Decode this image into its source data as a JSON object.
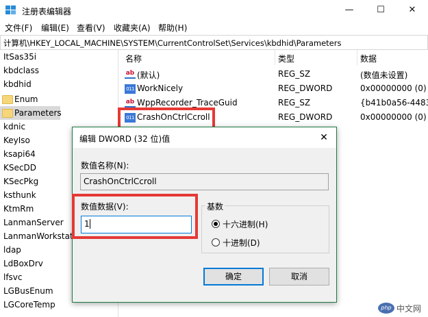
{
  "window": {
    "title": "注册表编辑器",
    "minimize": "—",
    "maximize": "☐",
    "close": "✕"
  },
  "menu": [
    "文件(F)",
    "编辑(E)",
    "查看(V)",
    "收藏夹(A)",
    "帮助(H)"
  ],
  "address": "计算机\\HKEY_LOCAL_MACHINE\\SYSTEM\\CurrentControlSet\\Services\\kbdhid\\Parameters",
  "tree": {
    "items": [
      {
        "label": "ItSas35i",
        "folder": false,
        "selected": false
      },
      {
        "label": "kbdclass",
        "folder": false,
        "selected": false
      },
      {
        "label": "kbdhid",
        "folder": false,
        "selected": false
      },
      {
        "label": "Enum",
        "folder": true,
        "selected": false
      },
      {
        "label": "Parameters",
        "folder": true,
        "selected": true
      },
      {
        "label": "kdnic",
        "folder": false,
        "selected": false
      },
      {
        "label": "KeyIso",
        "folder": false,
        "selected": false
      },
      {
        "label": "ksapi64",
        "folder": false,
        "selected": false
      },
      {
        "label": "KSecDD",
        "folder": false,
        "selected": false
      },
      {
        "label": "KSecPkg",
        "folder": false,
        "selected": false
      },
      {
        "label": "ksthunk",
        "folder": false,
        "selected": false
      },
      {
        "label": "KtmRm",
        "folder": false,
        "selected": false
      },
      {
        "label": "LanmanServer",
        "folder": false,
        "selected": false
      },
      {
        "label": "LanmanWorkstati",
        "folder": false,
        "selected": false
      },
      {
        "label": "ldap",
        "folder": false,
        "selected": false
      },
      {
        "label": "LdBoxDrv",
        "folder": false,
        "selected": false
      },
      {
        "label": "lfsvc",
        "folder": false,
        "selected": false
      },
      {
        "label": "LGBusEnum",
        "folder": false,
        "selected": false
      },
      {
        "label": "LGCoreTemp",
        "folder": false,
        "selected": false
      }
    ]
  },
  "list": {
    "headers": {
      "name": "名称",
      "type": "类型",
      "data": "数据"
    },
    "rows": [
      {
        "icon": "string-value-icon",
        "icon_text": "ab",
        "name": "(默认)",
        "type": "REG_SZ",
        "data": "(数值未设置)"
      },
      {
        "icon": "binary-value-icon",
        "icon_text": "011",
        "name": "WorkNicely",
        "type": "REG_DWORD",
        "data": "0x00000000 (0)"
      },
      {
        "icon": "string-value-icon",
        "icon_text": "ab",
        "name": "WppRecorder_TraceGuid",
        "type": "REG_SZ",
        "data": "{b41b0a56-4483"
      },
      {
        "icon": "binary-value-icon",
        "icon_text": "011",
        "name": "CrashOnCtrlCcroll",
        "type": "REG_DWORD",
        "data": "0x00000000 (0)"
      }
    ]
  },
  "dialog": {
    "title": "编辑 DWORD (32 位)值",
    "close": "✕",
    "value_name_label": "数值名称(N):",
    "value_name": "CrashOnCtrlCcroll",
    "value_data_label": "数值数据(V):",
    "value_data": "1",
    "base_label": "基数",
    "radio_hex": "十六进制(H)",
    "radio_dec": "十进制(D)",
    "hex_selected": true,
    "ok": "确定",
    "cancel": "取消"
  },
  "watermark": {
    "logo": "php",
    "text": "中文网"
  },
  "colors": {
    "highlight": "#e53935",
    "dialog_border": "#1b7a3e",
    "accent": "#0078d7"
  }
}
